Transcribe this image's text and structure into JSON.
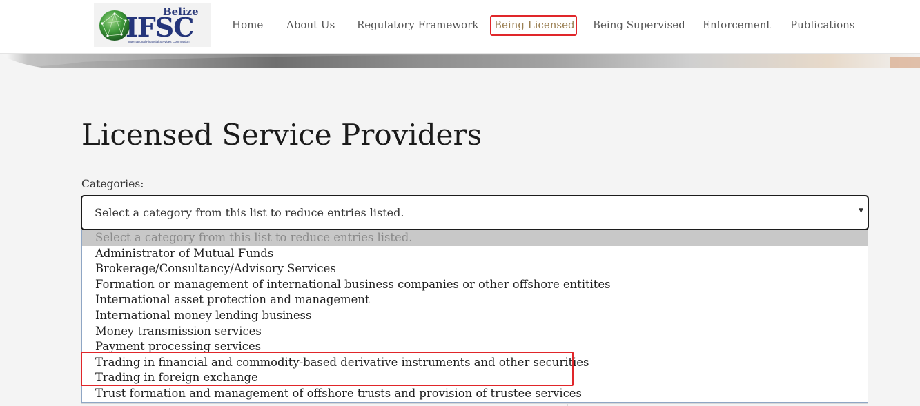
{
  "logo": {
    "top_text": "Belize",
    "main_text": "IFSC",
    "sub_text": "International Financial Services Commission"
  },
  "nav": {
    "items": [
      {
        "label": "Home"
      },
      {
        "label": "About Us"
      },
      {
        "label": "Regulatory Framework"
      },
      {
        "label": "Being Licensed"
      },
      {
        "label": "Being Supervised"
      },
      {
        "label": "Enforcement"
      },
      {
        "label": "Publications"
      }
    ],
    "active": "Being Licensed"
  },
  "page": {
    "title": "Licensed Service Providers",
    "categories_label": "Categories:"
  },
  "category_select": {
    "selected": "Select a category from this list to reduce entries listed.",
    "options": [
      "Select a category from this list to reduce entries listed.",
      "Administrator of Mutual Funds",
      "Brokerage/Consultancy/Advisory Services",
      "Formation or management of international business companies or other offshore entitites",
      "International asset protection and management",
      "International money lending business",
      "Money transmission services",
      "Payment processing services",
      "Trading in financial and commodity-based derivative instruments and other securities",
      "Trading in foreign exchange",
      "Trust formation and management of offshore trusts and provision of trustee services"
    ]
  },
  "colors": {
    "highlight": "#e0262a",
    "active_nav": "#9a7f52",
    "brand_blue": "#24357a",
    "brand_green": "#3a8d3a"
  }
}
